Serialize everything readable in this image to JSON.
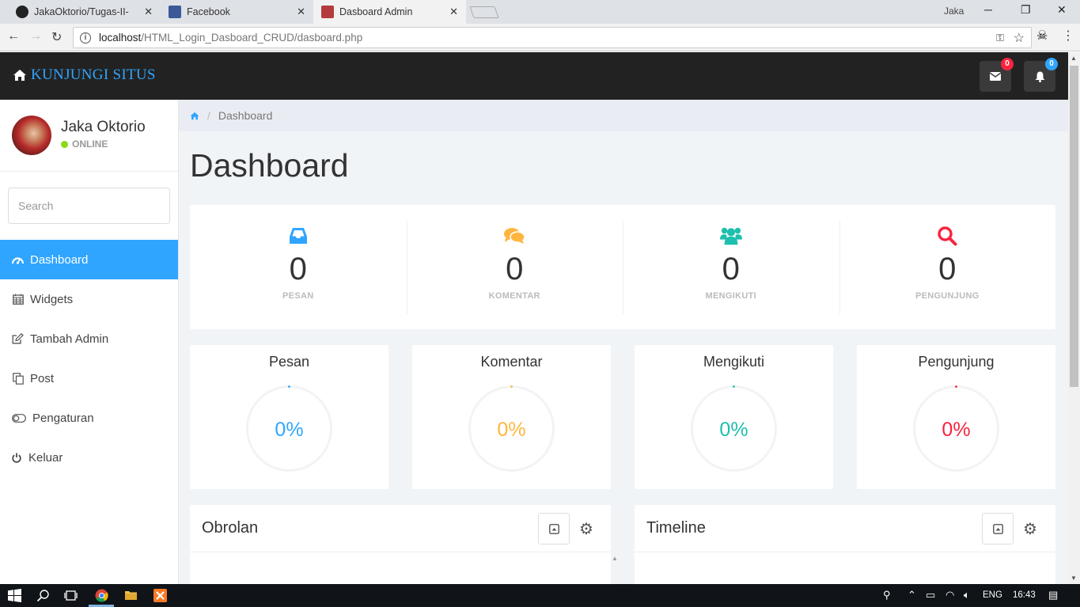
{
  "browser": {
    "tabs": [
      {
        "label": "JakaOktorio/Tugas-II-Set",
        "favicon": "github-icon"
      },
      {
        "label": "Facebook",
        "favicon": "facebook-icon"
      },
      {
        "label": "Dasboard Admin",
        "favicon": "site-icon"
      }
    ],
    "window_user": "Jaka",
    "url_host": "localhost",
    "url_path": "/HTML_Login_Dasboard_CRUD/dasboard.php"
  },
  "navbar": {
    "brand": "KUNJUNGI SITUS",
    "mail_count": "0",
    "notif_count": "0",
    "colors": {
      "accent": "#30a5ff",
      "mail_badge": "#f9243f",
      "notif_badge": "#30a5ff"
    }
  },
  "profile": {
    "name": "Jaka Oktorio",
    "status": "ONLINE"
  },
  "search": {
    "placeholder": "Search"
  },
  "menu": [
    {
      "label": "Dashboard",
      "icon": "dashboard-icon"
    },
    {
      "label": "Widgets",
      "icon": "calendar-icon"
    },
    {
      "label": "Tambah Admin",
      "icon": "edit-icon"
    },
    {
      "label": "Post",
      "icon": "copy-icon"
    },
    {
      "label": "Pengaturan",
      "icon": "toggle-icon"
    },
    {
      "label": "Keluar",
      "icon": "power-icon"
    }
  ],
  "breadcrumb": {
    "current": "Dashboard"
  },
  "page_title": "Dashboard",
  "stats": [
    {
      "value": "0",
      "label": "PESAN",
      "color": "#30a5ff",
      "icon": "inbox-icon"
    },
    {
      "value": "0",
      "label": "KOMENTAR",
      "color": "#ffb53e",
      "icon": "comments-icon"
    },
    {
      "value": "0",
      "label": "MENGIKUTI",
      "color": "#1ebfae",
      "icon": "users-icon"
    },
    {
      "value": "0",
      "label": "PENGUNJUNG",
      "color": "#f9243f",
      "icon": "search-icon"
    }
  ],
  "gauges": [
    {
      "title": "Pesan",
      "value": "0%",
      "percent": 0,
      "color": "#30a5ff"
    },
    {
      "title": "Komentar",
      "value": "0%",
      "percent": 0,
      "color": "#ffb53e"
    },
    {
      "title": "Mengikuti",
      "value": "0%",
      "percent": 0,
      "color": "#1ebfae"
    },
    {
      "title": "Pengunjung",
      "value": "0%",
      "percent": 0,
      "color": "#f9243f"
    }
  ],
  "panels": {
    "chat_title": "Obrolan",
    "timeline_title": "Timeline"
  },
  "taskbar": {
    "lang": "ENG",
    "time": "16:43"
  }
}
